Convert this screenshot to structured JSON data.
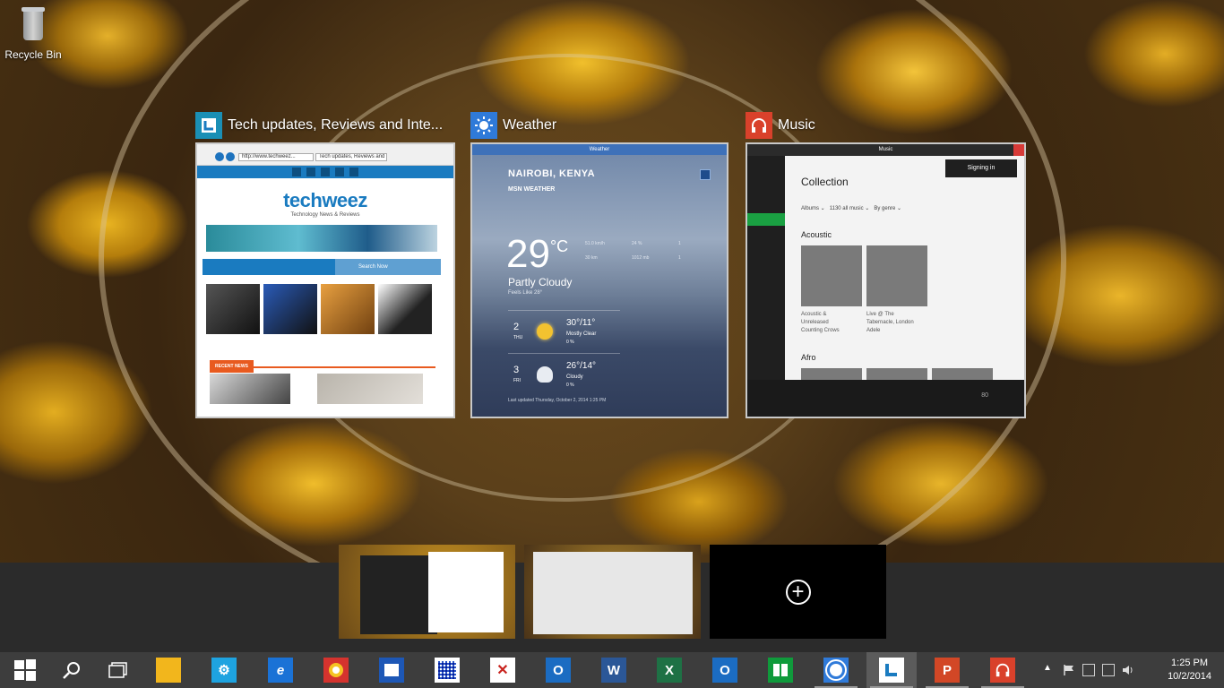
{
  "desktop": {
    "recycle_bin_label": "Recycle Bin"
  },
  "task_view": {
    "windows": [
      {
        "title": "Tech updates, Reviews and Inte...",
        "icon": "techweez-icon",
        "content": {
          "address": "http://www.techweez...",
          "tab": "Tech updates, Reviews and Ne...",
          "logo": "techweez",
          "tagline": "Technology News & Reviews",
          "search_label": "Search Now",
          "section": "RECENT NEWS"
        }
      },
      {
        "title": "Weather",
        "icon": "weather-sun-icon",
        "content": {
          "titlebar": "Weather",
          "city": "NAIROBI, KENYA",
          "source": "MSN WEATHER",
          "temp": "29",
          "unit": "°C",
          "condition": "Partly Cloudy",
          "feels_like": "Feels Like 28°",
          "stats": [
            "51.0 km/h",
            "24 %",
            "1",
            "30 km",
            "1012 mb",
            "1"
          ],
          "forecast": [
            {
              "day_num": "2",
              "day_name": "THU",
              "temps": "30°/11°",
              "desc": "Mostly Clear",
              "precip": "0 %"
            },
            {
              "day_num": "3",
              "day_name": "FRI",
              "temps": "26°/14°",
              "desc": "Cloudy",
              "precip": "0 %"
            }
          ],
          "updated": "Last updated Thursday, October 2, 2014 1:25 PM"
        }
      },
      {
        "title": "Music",
        "icon": "music-headphones-icon",
        "content": {
          "titlebar": "Music",
          "signin": "Signing in",
          "heading": "Collection",
          "filters": [
            "Albums ⌄",
            "1130 all music ⌄",
            "By genre ⌄"
          ],
          "genres": [
            "Acoustic",
            "Afro"
          ],
          "albums": [
            {
              "line1": "Acoustic &",
              "line2": "Unreleased",
              "line3": "Counting Crows"
            },
            {
              "line1": "Live @ The",
              "line2": "Tabernacle, London",
              "line3": "Adele"
            }
          ],
          "volume": "80"
        }
      }
    ]
  },
  "virtual_desktops": {
    "add_label": "+"
  },
  "taskbar": {
    "apps": [
      {
        "name": "start",
        "icon": "windows-logo-icon"
      },
      {
        "name": "search",
        "icon": "search-icon"
      },
      {
        "name": "task-view",
        "icon": "task-view-icon"
      },
      {
        "name": "file-explorer",
        "icon": "folder-icon"
      },
      {
        "name": "settings",
        "icon": "gear-icon"
      },
      {
        "name": "internet-explorer",
        "icon": "ie-icon"
      },
      {
        "name": "chrome",
        "icon": "chrome-icon"
      },
      {
        "name": "photo-app",
        "icon": "photo-icon"
      },
      {
        "name": "calculator-grid",
        "icon": "grid-app-icon"
      },
      {
        "name": "acrobat",
        "icon": "pdf-icon"
      },
      {
        "name": "outlook",
        "icon": "outlook-icon"
      },
      {
        "name": "word",
        "icon": "word-icon"
      },
      {
        "name": "excel",
        "icon": "excel-icon"
      },
      {
        "name": "outlook-2",
        "icon": "outlook-icon"
      },
      {
        "name": "store",
        "icon": "store-icon"
      },
      {
        "name": "weather",
        "icon": "weather-sun-icon"
      },
      {
        "name": "techweez-ie",
        "icon": "techweez-icon"
      },
      {
        "name": "powerpoint",
        "icon": "powerpoint-icon"
      },
      {
        "name": "music",
        "icon": "music-headphones-icon"
      }
    ],
    "clock": {
      "time": "1:25 PM",
      "date": "10/2/2014"
    }
  },
  "colors": {
    "taskbar_bg": "#3d3d3d",
    "desk_strip_bg": "#2b2b2b",
    "weather_blue": "#2f7ad9",
    "music_red": "#d9412b",
    "techweez_blue": "#1a7bc0"
  }
}
